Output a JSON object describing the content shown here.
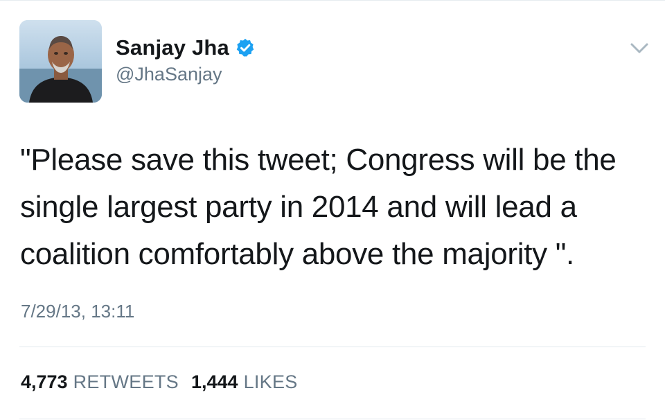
{
  "user": {
    "display_name": "Sanjay Jha",
    "handle": "@JhaSanjay",
    "verified_icon": "verified-badge-icon",
    "avatar": "profile-photo"
  },
  "menu": {
    "icon": "chevron-down-icon"
  },
  "tweet": {
    "text": "\"Please save this tweet; Congress will be the single largest party in 2014 and will lead a coalition comfortably above the majority \".",
    "timestamp": "7/29/13, 13:11"
  },
  "stats": {
    "retweets_count": "4,773",
    "retweets_label": "RETWEETS",
    "likes_count": "1,444",
    "likes_label": "LIKES"
  },
  "colors": {
    "text": "#14171a",
    "secondary": "#657786",
    "verified": "#1da1f2",
    "divider": "#e1e8ed"
  }
}
